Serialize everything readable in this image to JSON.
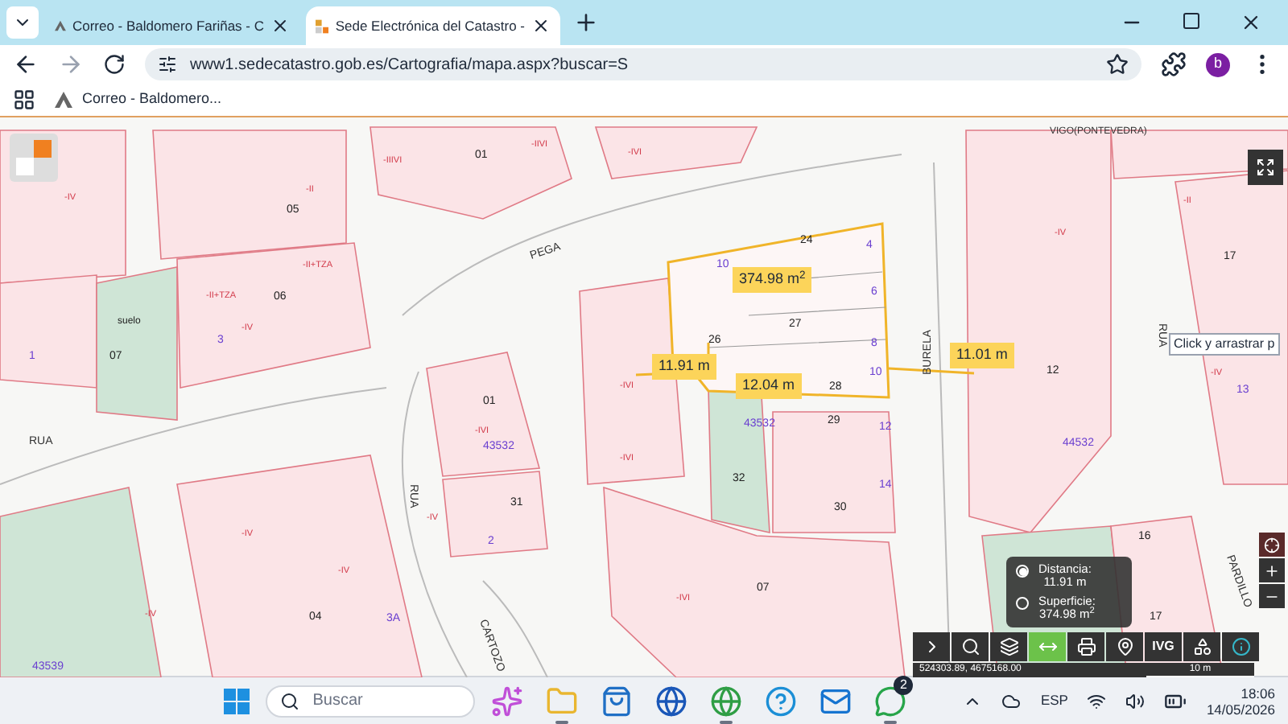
{
  "browser": {
    "tabs": [
      {
        "title": "Correo - Baldomero Fariñas - C",
        "selected": false
      },
      {
        "title": "Sede Electrónica del Catastro -",
        "selected": true
      }
    ],
    "address": "www1.sedecatastro.gob.es/Cartografia/mapa.aspx?buscar=S",
    "profile_initial": "b",
    "bookmarks": [
      {
        "title": "Correo - Baldomero..."
      }
    ]
  },
  "map": {
    "place": "VIGO(PONTEVEDRA)",
    "streets": [
      "PEGA",
      "RUA",
      "RUA",
      "BURELA",
      "RUA",
      "PARDILLO",
      "CARTOZO"
    ],
    "parcel_numbers": [
      "01",
      "05",
      "06",
      "07",
      "01",
      "31",
      "24",
      "27",
      "26",
      "28",
      "29",
      "32",
      "30",
      "07",
      "04",
      "17",
      "12",
      "16",
      "17"
    ],
    "house_numbers": [
      "1",
      "3",
      "2",
      "43532",
      "10",
      "4",
      "6",
      "8",
      "10",
      "43532",
      "12",
      "14",
      "44532",
      "3A",
      "43539",
      "13"
    ],
    "floor_codes": [
      "-IV",
      "-II+TZA",
      "-II+TZA",
      "-IV",
      "-II",
      "-IIIVI",
      "-IIVI",
      "-IVI",
      "-IVI",
      "-IVI",
      "-IVI",
      "-IV",
      "-IV",
      "-IV",
      "-IVI",
      "-IV",
      "-II",
      "-IV",
      "-IV"
    ],
    "land_labels": [
      "suelo"
    ],
    "measurements": [
      {
        "text": "374.98 m$^{2}$"
      },
      {
        "text": "11.91 m"
      },
      {
        "text": "12.04 m"
      },
      {
        "text": "11.01 m"
      }
    ],
    "hint": "Click y arrastrar p",
    "measure_panel": [
      {
        "label": "Distancia:",
        "value": "11.91 m",
        "selected": true
      },
      {
        "label": "Superficie:",
        "value": "374.98 m$^{2}$",
        "selected": false
      }
    ],
    "toolbar": [
      {
        "kind": "expand",
        "selected": false
      },
      {
        "kind": "search",
        "selected": false
      },
      {
        "kind": "layers",
        "selected": false
      },
      {
        "kind": "measure",
        "selected": true
      },
      {
        "kind": "print",
        "selected": false
      },
      {
        "kind": "pin",
        "selected": false
      },
      {
        "kind": "label",
        "label": "IVG",
        "selected": false
      },
      {
        "kind": "overlay",
        "selected": false
      },
      {
        "kind": "info",
        "selected": false
      }
    ],
    "coordinates": "524303.89, 4675168.00",
    "scale": "10 m"
  },
  "taskbar": {
    "search_placeholder": "Buscar",
    "apps": [
      {
        "kind": "copilot",
        "open": false
      },
      {
        "kind": "explorer",
        "open": true
      },
      {
        "kind": "store",
        "open": false
      },
      {
        "kind": "hp",
        "open": false
      },
      {
        "kind": "chrome",
        "open": true
      },
      {
        "kind": "help",
        "open": false
      },
      {
        "kind": "outlook",
        "open": false
      },
      {
        "kind": "whatsapp",
        "open": true,
        "badge": "2"
      }
    ],
    "language": "ESP",
    "time": "18:06",
    "date": "14/05/2026"
  }
}
